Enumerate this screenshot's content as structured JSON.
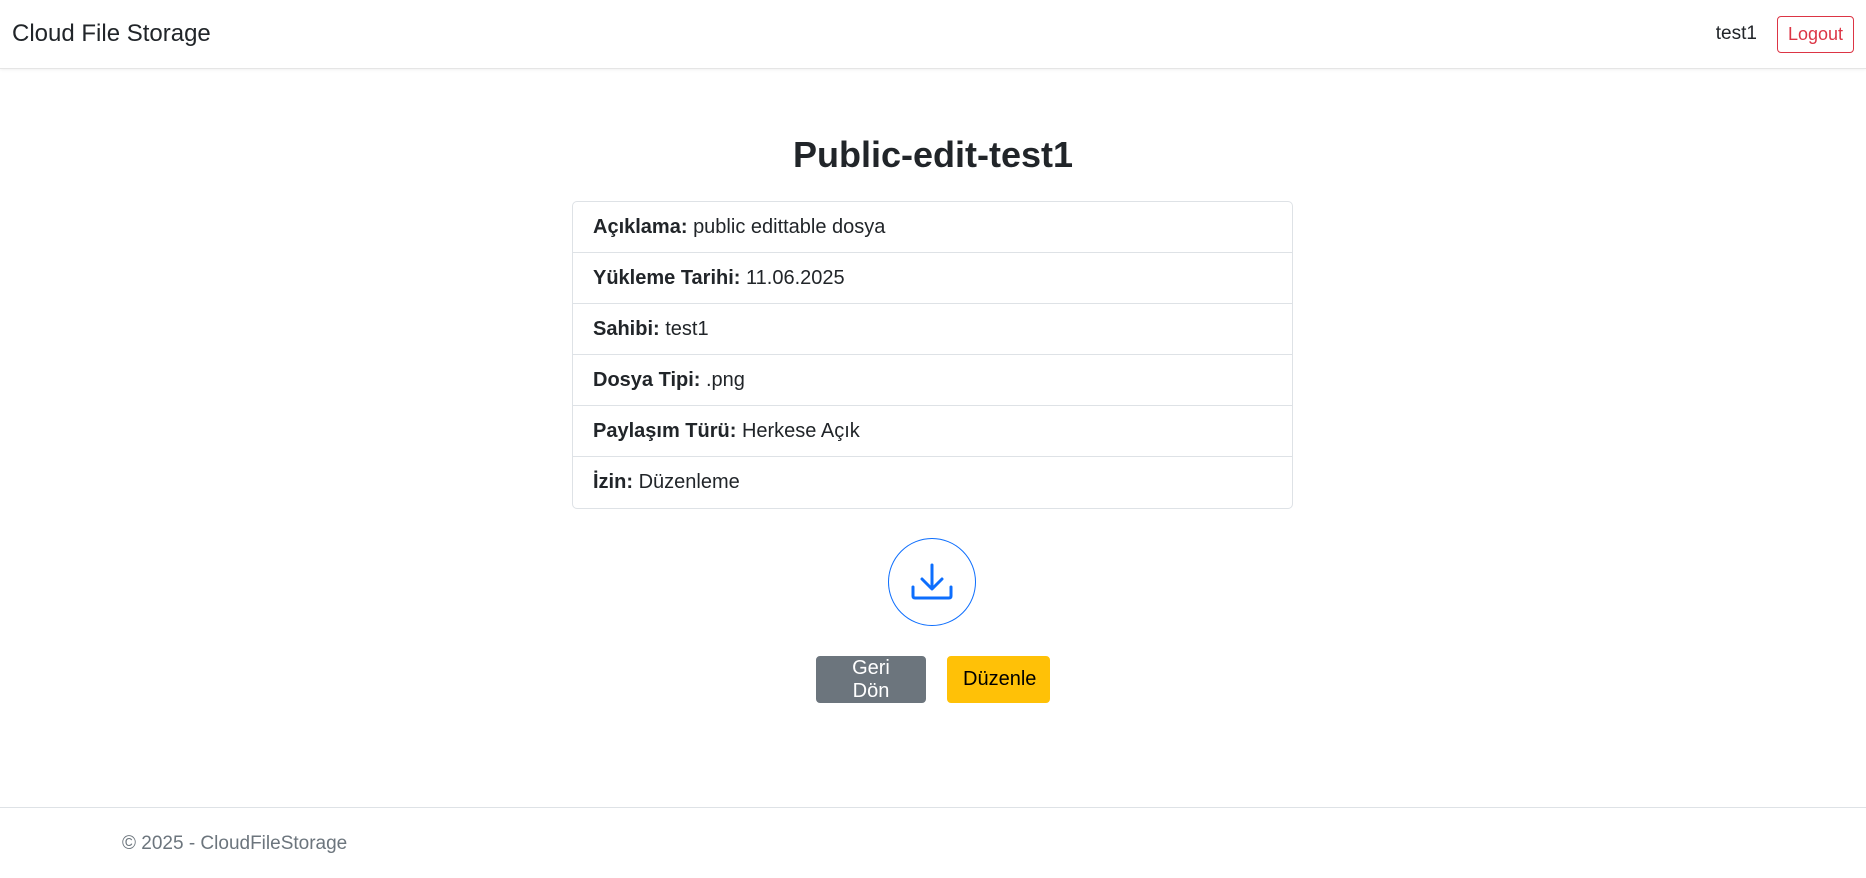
{
  "navbar": {
    "brand": "Cloud File Storage",
    "username": "test1",
    "logout_label": "Logout"
  },
  "page": {
    "title": "Public-edit-test1"
  },
  "details": [
    {
      "label": "Açıklama:",
      "value": "public edittable dosya"
    },
    {
      "label": "Yükleme Tarihi:",
      "value": "11.06.2025"
    },
    {
      "label": "Sahibi:",
      "value": "test1"
    },
    {
      "label": "Dosya Tipi:",
      "value": ".png"
    },
    {
      "label": "Paylaşım Türü:",
      "value": "Herkese Açık"
    },
    {
      "label": "İzin:",
      "value": "Düzenleme"
    }
  ],
  "download": {
    "icon": "download-icon",
    "color": "#0d6efd"
  },
  "actions": {
    "back_label": "Geri Dön",
    "edit_label": "Düzenle"
  },
  "colors": {
    "secondary": "#6c757d",
    "warning": "#ffc107",
    "danger": "#dc3545",
    "primary": "#0d6efd"
  },
  "footer": {
    "text": "© 2025 - CloudFileStorage"
  }
}
